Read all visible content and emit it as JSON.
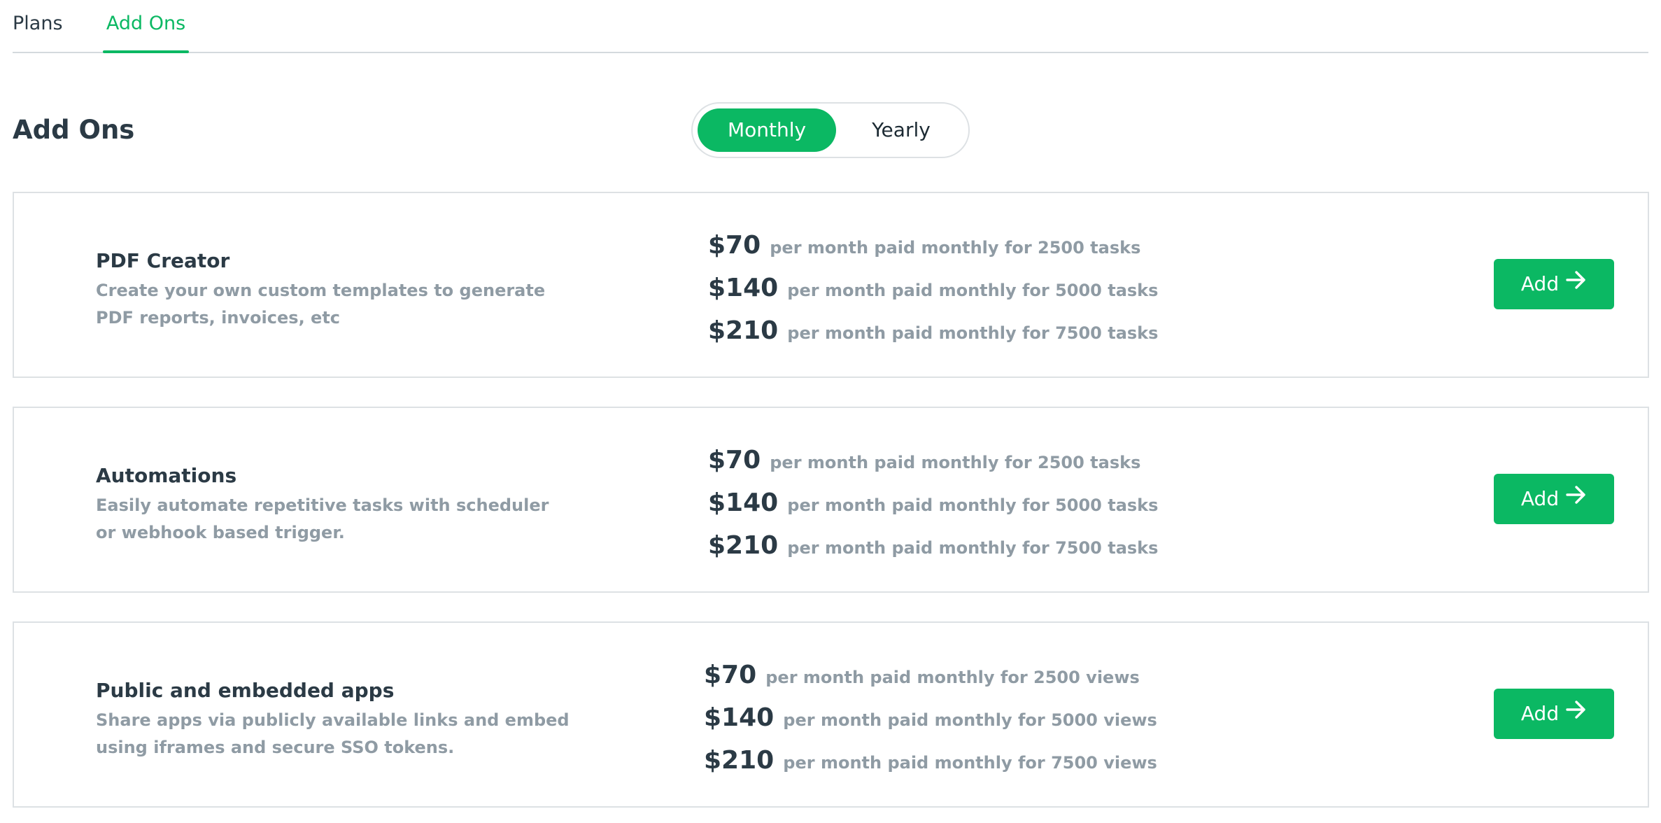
{
  "tabs": [
    {
      "label": "Plans",
      "active": false
    },
    {
      "label": "Add Ons",
      "active": true
    }
  ],
  "header": {
    "title": "Add Ons",
    "billing_toggle": {
      "options": [
        "Monthly",
        "Yearly"
      ],
      "selected": "Monthly"
    }
  },
  "addons": [
    {
      "title": "PDF Creator",
      "description": "Create your own custom templates to generate PDF reports, invoices, etc",
      "prices": [
        {
          "amount": "$70",
          "detail": "per month paid monthly for 2500 tasks"
        },
        {
          "amount": "$140",
          "detail": "per month paid monthly for 5000 tasks"
        },
        {
          "amount": "$210",
          "detail": "per month paid monthly for 7500 tasks"
        }
      ],
      "button_label": "Add"
    },
    {
      "title": "Automations",
      "description": "Easily automate repetitive tasks with scheduler or webhook based trigger.",
      "prices": [
        {
          "amount": "$70",
          "detail": "per month paid monthly for 2500 tasks"
        },
        {
          "amount": "$140",
          "detail": "per month paid monthly for 5000 tasks"
        },
        {
          "amount": "$210",
          "detail": "per month paid monthly for 7500 tasks"
        }
      ],
      "button_label": "Add"
    },
    {
      "title": "Public and embedded apps",
      "description": "Share apps via publicly available links and embed using iframes and secure SSO tokens.",
      "prices": [
        {
          "amount": "$70",
          "detail": "per month paid monthly for 2500 views"
        },
        {
          "amount": "$140",
          "detail": "per month paid monthly for 5000 views"
        },
        {
          "amount": "$210",
          "detail": "per month paid monthly for 7500 views"
        }
      ],
      "button_label": "Add"
    }
  ],
  "icons": {
    "add_button_icon": "arrow-right-icon"
  },
  "colors": {
    "accent": "#0bb863",
    "text_primary": "#2b3a45",
    "text_muted": "#8f9ba4",
    "border": "#dde1e4"
  }
}
